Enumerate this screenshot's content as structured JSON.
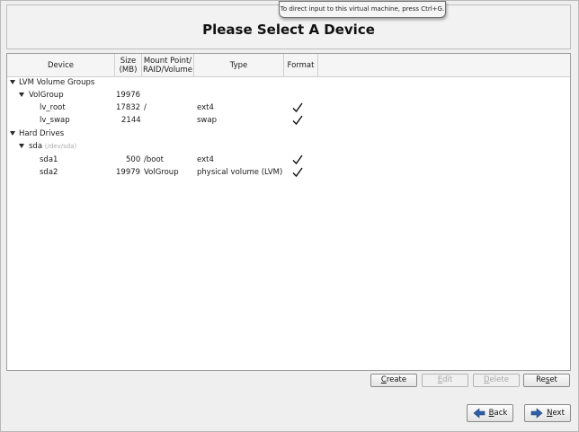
{
  "header": {
    "title": "Please Select A Device",
    "tooltip": "To direct input to this virtual machine, press Ctrl+G."
  },
  "columns": {
    "device": "Device",
    "size_line1": "Size",
    "size_line2": "(MB)",
    "mount_line1": "Mount Point/",
    "mount_line2": "RAID/Volume",
    "type": "Type",
    "format": "Format"
  },
  "rows": [
    {
      "device": "LVM Volume Groups",
      "expander": true,
      "size": "",
      "mount": "",
      "type": "",
      "format": false
    },
    {
      "device": "VolGroup",
      "expander": true,
      "size": "19976",
      "mount": "",
      "type": "",
      "format": false
    },
    {
      "device": "lv_root",
      "expander": false,
      "size": "17832",
      "mount": "/",
      "type": "ext4",
      "format": true
    },
    {
      "device": "lv_swap",
      "expander": false,
      "size": "2144",
      "mount": "",
      "type": "swap",
      "format": true
    },
    {
      "device": "Hard Drives",
      "expander": true,
      "size": "",
      "mount": "",
      "type": "",
      "format": false
    },
    {
      "device": "sda",
      "device_path": "(/dev/sda)",
      "expander": true,
      "size": "",
      "mount": "",
      "type": "",
      "format": false
    },
    {
      "device": "sda1",
      "expander": false,
      "size": "500",
      "mount": "/boot",
      "type": "ext4",
      "format": true
    },
    {
      "device": "sda2",
      "expander": false,
      "size": "19979",
      "mount": "VolGroup",
      "type": "physical volume (LVM)",
      "format": true
    }
  ],
  "actions": {
    "create": {
      "pre": "",
      "u": "C",
      "post": "reate"
    },
    "edit": {
      "pre": "",
      "u": "E",
      "post": "dit"
    },
    "delete": {
      "pre": "",
      "u": "D",
      "post": "elete"
    },
    "reset": {
      "pre": "Re",
      "u": "s",
      "post": "et"
    }
  },
  "nav": {
    "back": {
      "pre": "",
      "u": "B",
      "post": "ack"
    },
    "next": {
      "pre": "",
      "u": "N",
      "post": "ext"
    }
  },
  "colors": {
    "nav_arrow": "#2f5fa8",
    "check": "#111111"
  }
}
